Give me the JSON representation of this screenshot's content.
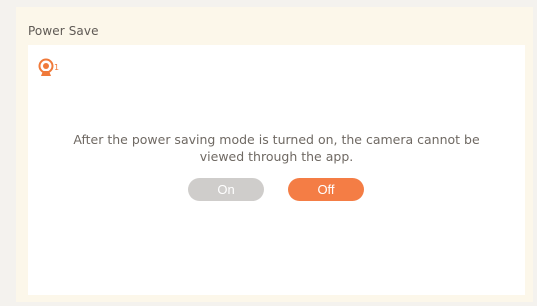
{
  "panel": {
    "title": "Power Save"
  },
  "camera": {
    "icon": "webcam-icon",
    "index": "1",
    "color": "#f07a3a"
  },
  "message": {
    "line1": "After the power saving mode is turned on, the camera cannot be",
    "line2": "viewed through the app."
  },
  "toggle": {
    "on_label": "On",
    "off_label": "Off",
    "selected": "Off",
    "on_color": "#cfcdcb",
    "off_color": "#f47d45"
  }
}
